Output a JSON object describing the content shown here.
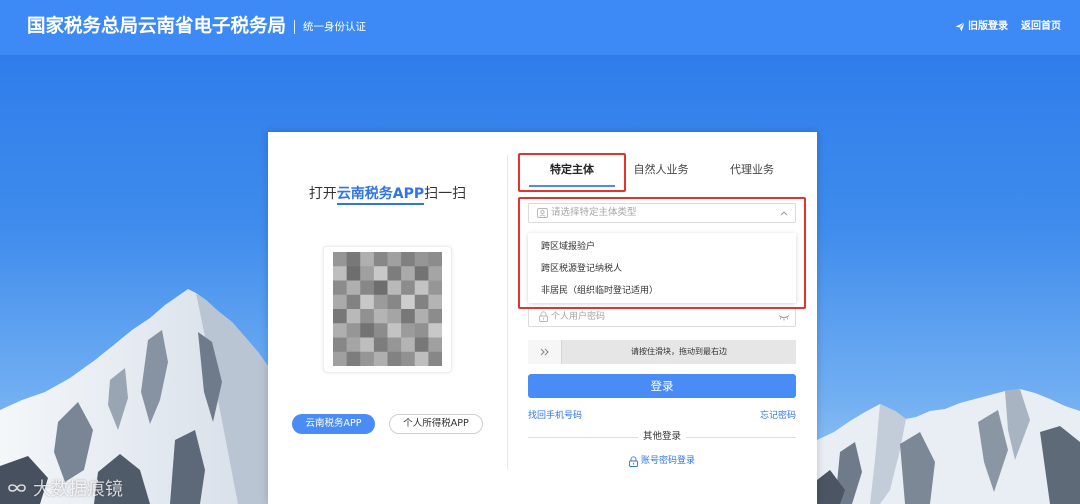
{
  "header": {
    "title": "国家税务总局云南省电子税务局",
    "subtitle": "统一身份认证",
    "links": [
      {
        "label": "旧版登录",
        "icon": "paper-plane-icon"
      },
      {
        "label": "返回首页"
      }
    ]
  },
  "qr_panel": {
    "prompt": {
      "prefix": "打开",
      "app_name": "云南税务APP",
      "suffix": "扫一扫"
    },
    "app_buttons": [
      {
        "label": "云南税务APP",
        "selected": true
      },
      {
        "label": "个人所得税APP",
        "selected": false
      }
    ]
  },
  "login_panel": {
    "tabs": [
      {
        "label": "特定主体",
        "active": true
      },
      {
        "label": "自然人业务",
        "active": false
      },
      {
        "label": "代理业务",
        "active": false
      }
    ],
    "subject_type_select": {
      "placeholder": "请选择特定主体类型",
      "icon": "id-card-icon",
      "expanded": true,
      "options": [
        "跨区域报验户",
        "跨区税源登记纳税人",
        "非居民（组织临时登记适用）"
      ]
    },
    "password_field": {
      "placeholder": "个人用户密码",
      "icon": "lock-icon",
      "toggle_icon": "eye-closed-icon"
    },
    "slider_captcha": {
      "hint": "请按住滑块，拖动到最右边",
      "handle_icon": "double-chevron-right-icon"
    },
    "login_button": "登录",
    "recover_phone_link": "找回手机号码",
    "forgot_password_link": "忘记密码",
    "other_login_label": "其他登录",
    "account_password_login": {
      "label": "账号密码登录",
      "icon": "lock-icon"
    }
  },
  "watermark": "大数据痕镜",
  "colors": {
    "header": "#3d8af7",
    "primary": "#4a8cf5",
    "link": "#2f74e8",
    "highlight": "#e5322d"
  }
}
